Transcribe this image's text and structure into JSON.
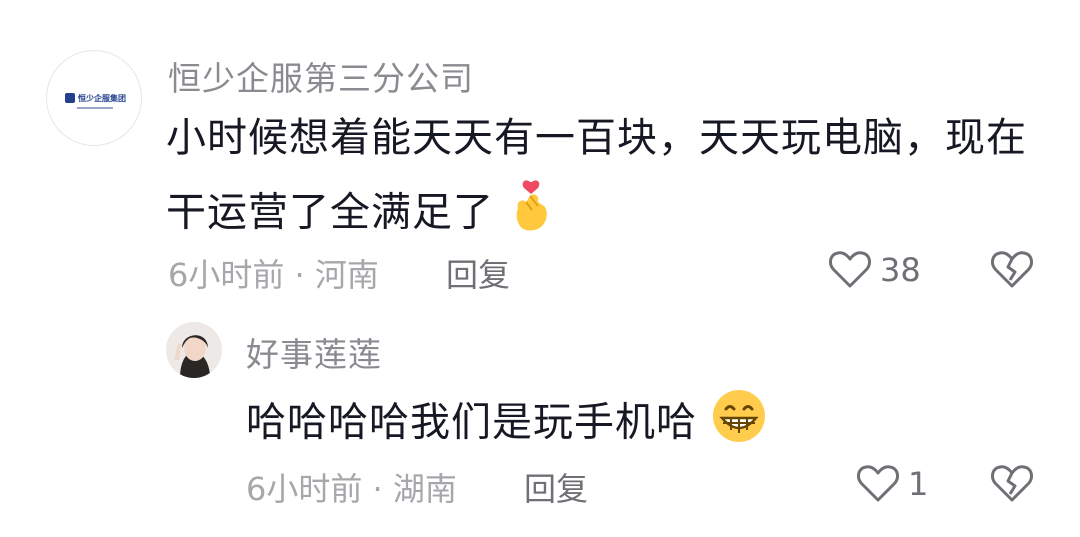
{
  "comment": {
    "username": "恒少企服第三分公司",
    "avatar_logo_text": "恒少企服集团",
    "text_line1": "小时候想着能天天有一百块，天天玩电脑，现在",
    "text_line2": "干运营了全满足了",
    "emoji": "finger-heart-emoji",
    "time": "6小时前",
    "location": "河南",
    "meta": "6小时前 · 河南",
    "reply_label": "回复",
    "likes": "38"
  },
  "reply": {
    "username": "好事莲莲",
    "text": "哈哈哈哈我们是玩手机哈",
    "emoji": "grinning-face-emoji",
    "meta": "6小时前 · 湖南",
    "reply_label": "回复",
    "likes": "1"
  },
  "icons": {
    "like": "heart-outline-icon",
    "dislike": "broken-heart-icon"
  }
}
